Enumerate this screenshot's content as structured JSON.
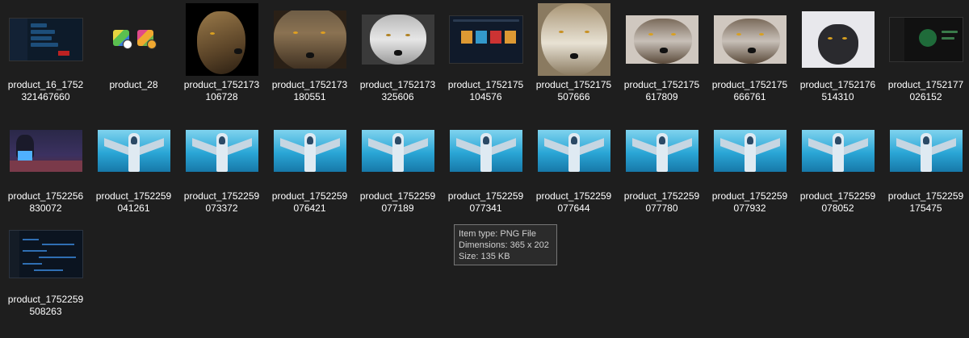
{
  "files": [
    {
      "name_line1": "product_16_1752",
      "name_line2": "321467660",
      "icon": "app-ui-thumbnail"
    },
    {
      "name_line1": "product_28",
      "name_line2": "",
      "icon": "colored-cubes-icon"
    },
    {
      "name_line1": "product_1752173",
      "name_line2": "106728",
      "icon": "wolf-photo"
    },
    {
      "name_line1": "product_1752173",
      "name_line2": "180551",
      "icon": "wolf-photo"
    },
    {
      "name_line1": "product_1752173",
      "name_line2": "325606",
      "icon": "wolf-photo"
    },
    {
      "name_line1": "product_1752175",
      "name_line2": "104576",
      "icon": "app-ui-thumbnail"
    },
    {
      "name_line1": "product_1752175",
      "name_line2": "507666",
      "icon": "wolf-photo"
    },
    {
      "name_line1": "product_1752175",
      "name_line2": "617809",
      "icon": "wolf-photo"
    },
    {
      "name_line1": "product_1752175",
      "name_line2": "666761",
      "icon": "wolf-photo"
    },
    {
      "name_line1": "product_1752176",
      "name_line2": "514310",
      "icon": "wolf-photo"
    },
    {
      "name_line1": "product_1752177",
      "name_line2": "026152",
      "icon": "app-ui-thumbnail"
    },
    {
      "name_line1": "product_1752256",
      "name_line2": "830072",
      "icon": "anime-thumbnail"
    },
    {
      "name_line1": "product_1752259",
      "name_line2": "041261",
      "icon": "jet-photo"
    },
    {
      "name_line1": "product_1752259",
      "name_line2": "073372",
      "icon": "jet-photo"
    },
    {
      "name_line1": "product_1752259",
      "name_line2": "076421",
      "icon": "jet-photo"
    },
    {
      "name_line1": "product_1752259",
      "name_line2": "077189",
      "icon": "jet-photo"
    },
    {
      "name_line1": "product_1752259",
      "name_line2": "077341",
      "icon": "jet-photo"
    },
    {
      "name_line1": "product_1752259",
      "name_line2": "077644",
      "icon": "jet-photo"
    },
    {
      "name_line1": "product_1752259",
      "name_line2": "077780",
      "icon": "jet-photo"
    },
    {
      "name_line1": "product_1752259",
      "name_line2": "077932",
      "icon": "jet-photo"
    },
    {
      "name_line1": "product_1752259",
      "name_line2": "078052",
      "icon": "jet-photo"
    },
    {
      "name_line1": "product_1752259",
      "name_line2": "175475",
      "icon": "jet-photo"
    },
    {
      "name_line1": "product_1752259",
      "name_line2": "508263",
      "icon": "code-editor-thumbnail"
    }
  ],
  "tooltip": {
    "item_type": "Item type: PNG File",
    "dimensions": "Dimensions: 365 x 202",
    "size": "Size: 135 KB"
  },
  "colors": {
    "background": "#1e1e1e",
    "text": "#ffffff",
    "tooltip_bg": "#2b2b2b",
    "tooltip_border": "#767676"
  }
}
